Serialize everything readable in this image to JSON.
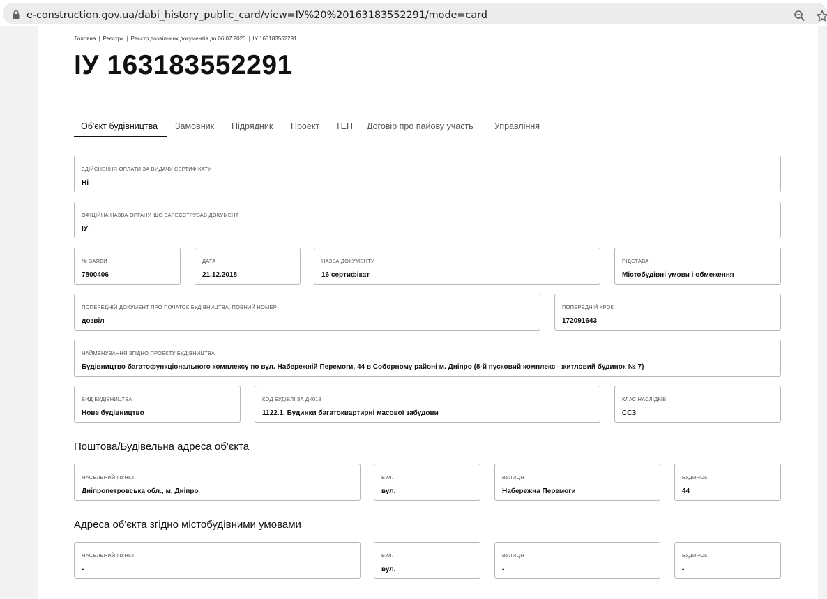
{
  "browser": {
    "url": "e-construction.gov.ua/dabi_history_public_card/view=ІУ%20%20163183552291/mode=card",
    "icons": [
      "lock-icon",
      "zoom-icon",
      "star-icon"
    ]
  },
  "breadcrumb": [
    "Головна",
    "Реєстри",
    "Реєстр дозвільних документів до 06.07.2020",
    "ІУ 163183552291"
  ],
  "title": "ІУ 163183552291",
  "tabs": [
    "Об'єкт будівництва",
    "Замовник",
    "Підрядник",
    "Проект",
    "ТЕП",
    "Договір про пайову участь",
    "Управління"
  ],
  "active_tab": "Об'єкт будівництва",
  "fields": {
    "payment": {
      "label": "Здійснення оплати за видачу сертифікату",
      "value": "Ні"
    },
    "authority": {
      "label": "Офіційна назва органу, що зареєстрував документ",
      "value": "ІУ"
    },
    "application_no": {
      "label": "№ заяви",
      "value": "7800406"
    },
    "date": {
      "label": "Дата",
      "value": "21.12.2018"
    },
    "doc_name": {
      "label": "Назва документу",
      "value": "16 сертифікат"
    },
    "basis": {
      "label": "Підстава",
      "value": "Містобудівні умови і обмеження"
    },
    "prev_doc": {
      "label": "Попередній документ про початок будівництва, повний номер",
      "value": "дозвіл"
    },
    "prev_step": {
      "label": "Попередній крок",
      "value": "172091643"
    },
    "project_name": {
      "label": "Найменування згідно проекту будівництва",
      "value": "Будівництво багатофункціонального комплексу по вул. Набережній Перемоги, 44 в Соборному районі м. Дніпро (8-й пусковий комплекс - житловий будинок № 7)"
    },
    "construction_type": {
      "label": "Вид будівництва",
      "value": "Нове будівництво"
    },
    "building_code": {
      "label": "Код будівлі за ДК018",
      "value": "1122.1. Будинки багатоквартирні масової забудови"
    },
    "consequence_class": {
      "label": "Клас наслідків",
      "value": "СС3"
    }
  },
  "postal_address": {
    "title": "Поштова/Будівельна адреса об'єкта",
    "settlement": {
      "label": "Населений пункт",
      "value": "Дніпропетровська обл., м. Дніпро"
    },
    "street_type": {
      "label": "вул.",
      "value": "вул."
    },
    "street": {
      "label": "Вулиця",
      "value": "Набережна Перемоги"
    },
    "building": {
      "label": "Будинок",
      "value": "44"
    }
  },
  "planning_address": {
    "title": "Адреса об'єкта згідно містобудівними умовами",
    "settlement": {
      "label": "Населений пункт",
      "value": "-"
    },
    "street_type": {
      "label": "вул.",
      "value": "вул."
    },
    "street": {
      "label": "Вулиця",
      "value": "-"
    },
    "building": {
      "label": "Будинок",
      "value": "-"
    }
  }
}
